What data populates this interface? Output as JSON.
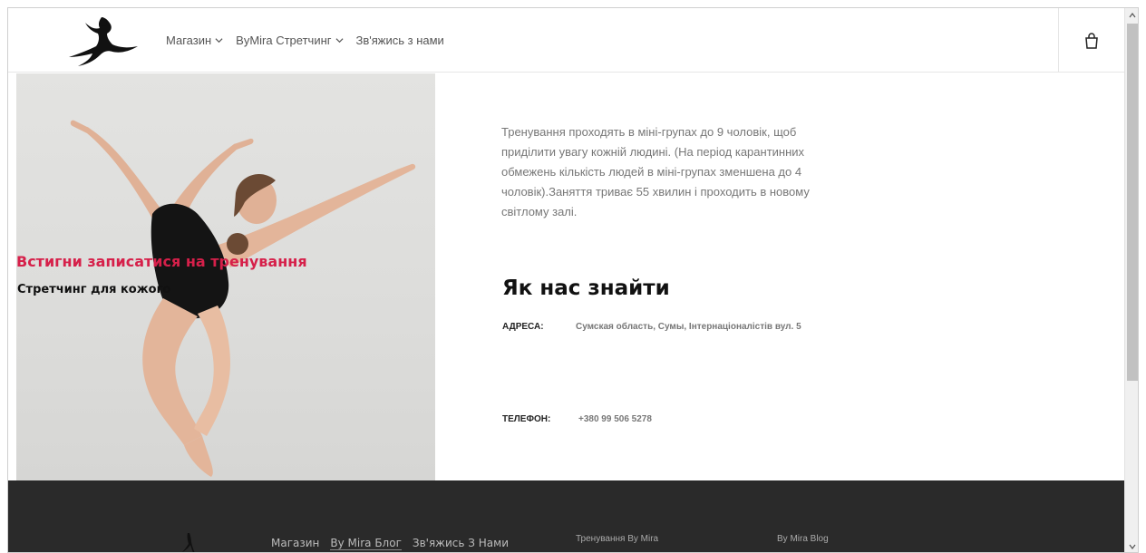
{
  "header": {
    "nav": [
      {
        "label": "Магазин",
        "has_dropdown": true
      },
      {
        "label": "ByMira Стретчинг",
        "has_dropdown": true
      },
      {
        "label": "Зв'яжись з нами",
        "has_dropdown": false
      }
    ],
    "cart_icon": "shopping-bag-icon"
  },
  "hero": {
    "title": "Встигни записатися на тренування",
    "subtitle": "Стретчинг для кожого",
    "title_color": "#d6204a"
  },
  "content": {
    "description": "Тренування проходять в міні-групах до 9 чоловік, щоб приділити увагу кожній людині. (На період карантинних обмежень кількість людей в міні-групах зменшена до 4 чоловік).Заняття триває 55 хвилин і проходить в новому світлому залі.",
    "find_title": "Як нас знайти",
    "address_label": "АДРЕСА:",
    "address_value": "Сумская область, Сумы, Інтернаціоналістів вул. 5",
    "phone_label": "ТЕЛЕФОН:",
    "phone_value": "+380 99 506 5278"
  },
  "footer": {
    "links": [
      "Магазин",
      "By Mira Блог",
      "Зв'яжись З Нами"
    ],
    "active_link": "By Mira Блог",
    "column_training": "Тренування By Mira",
    "column_blog": "By Mira Blog",
    "background": "#2a2a2a"
  }
}
